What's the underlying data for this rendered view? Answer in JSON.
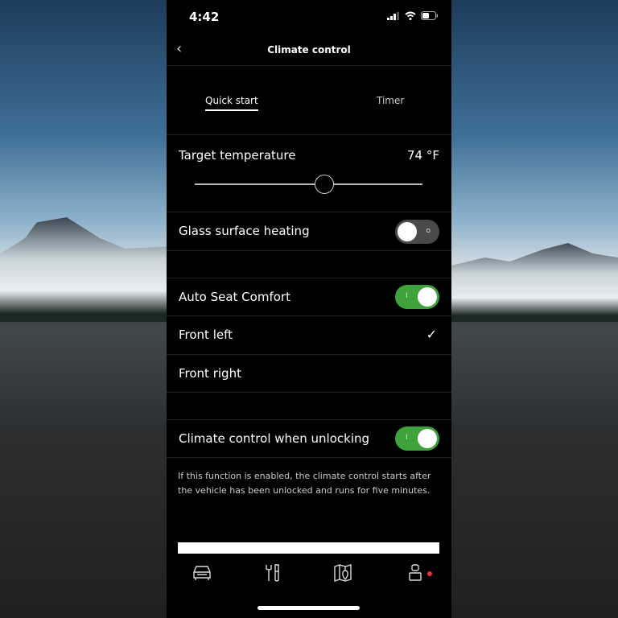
{
  "status_bar": {
    "time": "4:42"
  },
  "header": {
    "title": "Climate control",
    "back_icon": "chevron-left-icon"
  },
  "tabs": [
    {
      "label": "Quick start",
      "active": true
    },
    {
      "label": "Timer",
      "active": false
    }
  ],
  "target_temperature": {
    "label": "Target temperature",
    "value": "74 °F",
    "slider_fraction": 0.57
  },
  "glass_surface_heating": {
    "label": "Glass surface heating",
    "on": false
  },
  "auto_seat_comfort": {
    "label": "Auto Seat Comfort",
    "on": true
  },
  "seats": [
    {
      "label": "Front left",
      "selected": true
    },
    {
      "label": "Front right",
      "selected": false
    }
  ],
  "climate_when_unlocking": {
    "label": "Climate control when unlocking",
    "on": true,
    "description": "If this function is enabled, the climate control starts after the vehicle has been unlocked and runs for five minutes."
  },
  "bottom_nav": [
    {
      "icon": "car-icon"
    },
    {
      "icon": "tools-icon"
    },
    {
      "icon": "map-icon"
    },
    {
      "icon": "profile-icon",
      "badge_color": "#e8323c"
    }
  ],
  "colors": {
    "toggle_on": "#3da33a",
    "toggle_off": "#4a4a4a",
    "background": "#000000"
  }
}
